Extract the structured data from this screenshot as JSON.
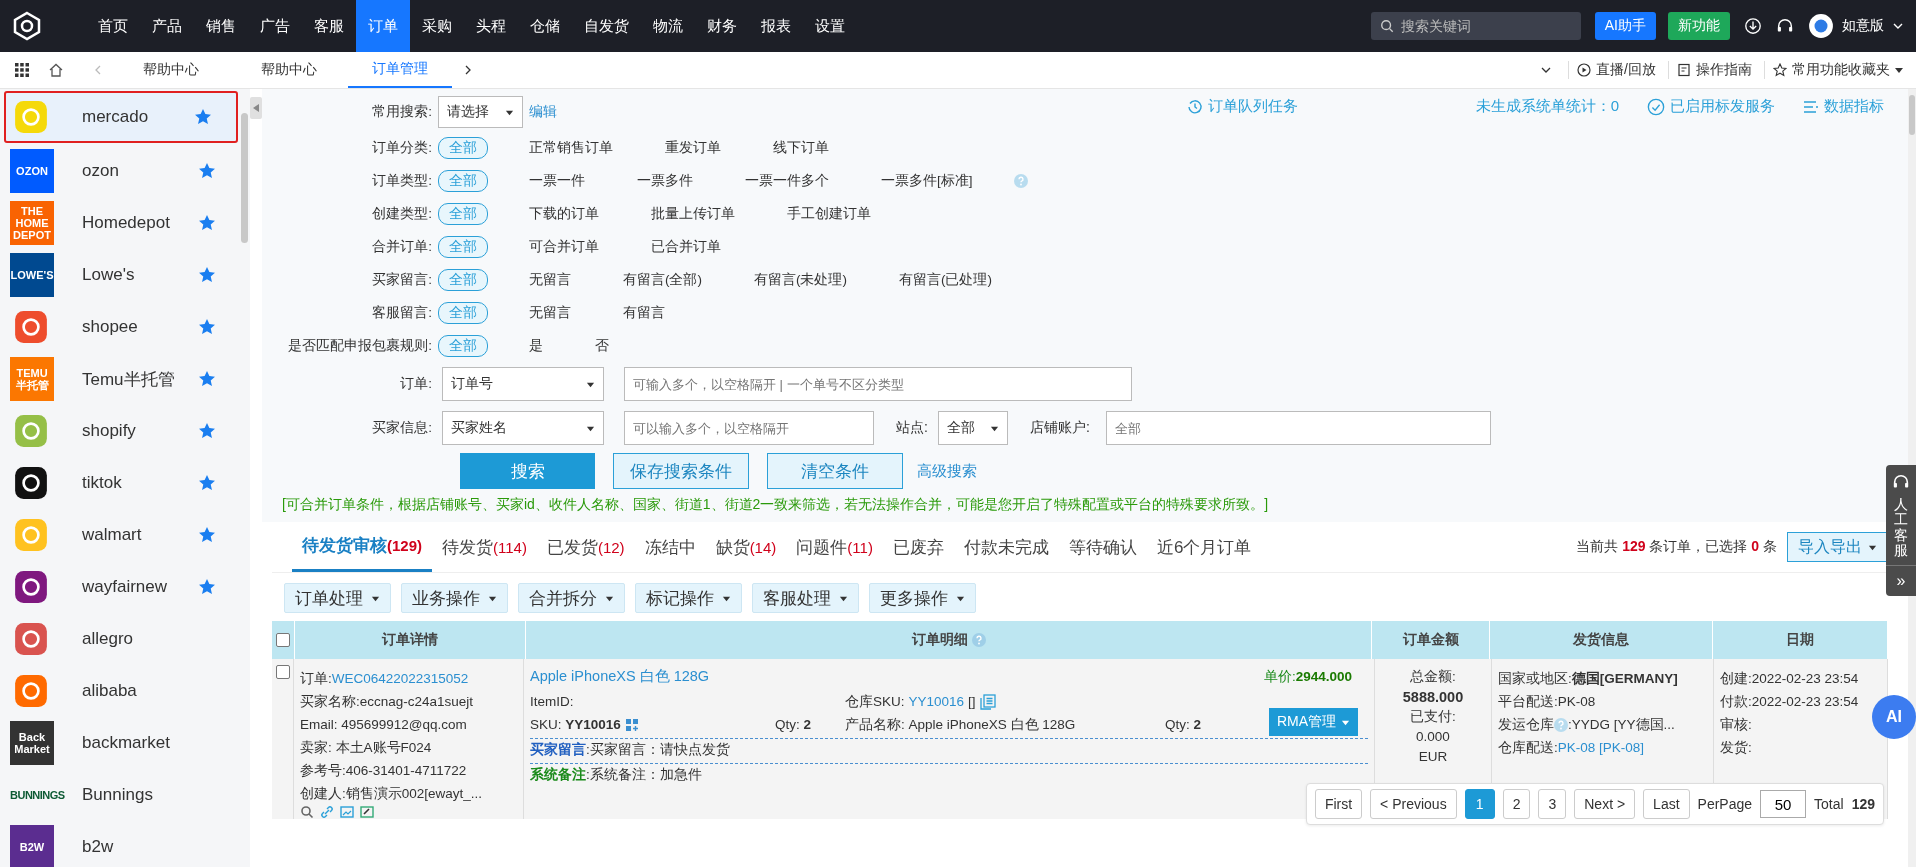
{
  "topnav": {
    "menu": [
      {
        "label": "首页",
        "selected": false
      },
      {
        "label": "产品",
        "selected": false
      },
      {
        "label": "销售",
        "selected": false
      },
      {
        "label": "广告",
        "selected": false
      },
      {
        "label": "客服",
        "selected": false
      },
      {
        "label": "订单",
        "selected": true
      },
      {
        "label": "采购",
        "selected": false
      },
      {
        "label": "头程",
        "selected": false
      },
      {
        "label": "仓储",
        "selected": false
      },
      {
        "label": "自发货",
        "selected": false
      },
      {
        "label": "物流",
        "selected": false
      },
      {
        "label": "财务",
        "selected": false
      },
      {
        "label": "报表",
        "selected": false
      },
      {
        "label": "设置",
        "selected": false
      }
    ],
    "search": {
      "placeholder": "搜索关键词"
    },
    "ai_button": "AI助手",
    "new_button": "新功能",
    "user": "如意版"
  },
  "breadcrumb": {
    "tabs": [
      {
        "label": "帮助中心",
        "selected": false
      },
      {
        "label": "帮助中心",
        "selected": false
      },
      {
        "label": "订单管理",
        "selected": true
      }
    ],
    "right_links": [
      "直播/回放",
      "操作指南",
      "常用功能收藏夹"
    ]
  },
  "sidebar": {
    "items": [
      {
        "name": "mercado",
        "kind": "glyph",
        "color": "#f5d90a",
        "starred": true,
        "selected": true
      },
      {
        "name": "ozon",
        "kind": "tile",
        "logo_text": "OZON",
        "color": "#005bff",
        "starred": true,
        "selected": false
      },
      {
        "name": "Homedepot",
        "kind": "tile",
        "logo_text": "THE HOME DEPOT",
        "color": "#f96302",
        "starred": true,
        "selected": false
      },
      {
        "name": "Lowe's",
        "kind": "tile",
        "logo_text": "LOWE'S",
        "color": "#004990",
        "starred": true,
        "selected": false
      },
      {
        "name": "shopee",
        "kind": "glyph",
        "color": "#ee4d2d",
        "starred": true,
        "selected": false
      },
      {
        "name": "Temu半托管",
        "kind": "tile",
        "logo_text": "TEMU 半托管",
        "color": "#fb7701",
        "starred": true,
        "selected": false
      },
      {
        "name": "shopify",
        "kind": "glyph",
        "color": "#95bf47",
        "starred": true,
        "selected": false
      },
      {
        "name": "tiktok",
        "kind": "glyph",
        "color": "#111111",
        "starred": true,
        "selected": false
      },
      {
        "name": "walmart",
        "kind": "glyph",
        "color": "#ffc220",
        "starred": true,
        "selected": false
      },
      {
        "name": "wayfairnew",
        "kind": "glyph",
        "color": "#7f187f",
        "starred": true,
        "selected": false
      },
      {
        "name": "allegro",
        "kind": "glyph",
        "color": "#d9534f",
        "starred": false,
        "selected": false
      },
      {
        "name": "alibaba",
        "kind": "glyph",
        "color": "#ff6a00",
        "starred": false,
        "selected": false
      },
      {
        "name": "backmarket",
        "kind": "tile",
        "logo_text": "Back Market",
        "color": "#333333",
        "starred": false,
        "selected": false
      },
      {
        "name": "Bunnings",
        "kind": "wordmark",
        "logo_text": "BUNNINGS",
        "color": "#0d5a34",
        "starred": false,
        "selected": false
      },
      {
        "name": "b2w",
        "kind": "tile",
        "logo_text": "B2W",
        "color": "#5b2d90",
        "starred": false,
        "selected": false
      }
    ]
  },
  "top_links": {
    "queue": "订单队列任务",
    "stats": "未生成系统单统计：0",
    "service": "已启用标发服务",
    "metrics": "数据指标"
  },
  "common_search": {
    "label": "常用搜索:",
    "select": "请选择",
    "edit": "编辑"
  },
  "filters": [
    {
      "label": "订单分类:",
      "help": false,
      "options": [
        {
          "label": "全部",
          "selected": true
        },
        {
          "label": "正常销售订单",
          "selected": false
        },
        {
          "label": "重发订单",
          "selected": false
        },
        {
          "label": "线下订单",
          "selected": false
        }
      ]
    },
    {
      "label": "订单类型:",
      "help": true,
      "options": [
        {
          "label": "全部",
          "selected": true
        },
        {
          "label": "一票一件",
          "selected": false
        },
        {
          "label": "一票多件",
          "selected": false
        },
        {
          "label": "一票一件多个",
          "selected": false
        },
        {
          "label": "一票多件[标准]",
          "selected": false
        }
      ]
    },
    {
      "label": "创建类型:",
      "help": false,
      "options": [
        {
          "label": "全部",
          "selected": true
        },
        {
          "label": "下载的订单",
          "selected": false
        },
        {
          "label": "批量上传订单",
          "selected": false
        },
        {
          "label": "手工创建订单",
          "selected": false
        }
      ]
    },
    {
      "label": "合并订单:",
      "help": false,
      "options": [
        {
          "label": "全部",
          "selected": true
        },
        {
          "label": "可合并订单",
          "selected": false
        },
        {
          "label": "已合并订单",
          "selected": false
        }
      ]
    },
    {
      "label": "买家留言:",
      "help": false,
      "options": [
        {
          "label": "全部",
          "selected": true
        },
        {
          "label": "无留言",
          "selected": false
        },
        {
          "label": "有留言(全部)",
          "selected": false
        },
        {
          "label": "有留言(未处理)",
          "selected": false
        },
        {
          "label": "有留言(已处理)",
          "selected": false
        }
      ]
    },
    {
      "label": "客服留言:",
      "help": false,
      "options": [
        {
          "label": "全部",
          "selected": true
        },
        {
          "label": "无留言",
          "selected": false
        },
        {
          "label": "有留言",
          "selected": false
        }
      ]
    },
    {
      "label": "是否匹配申报包裹规则:",
      "help": false,
      "options": [
        {
          "label": "全部",
          "selected": true
        },
        {
          "label": "是",
          "selected": false
        },
        {
          "label": "否",
          "selected": false
        }
      ]
    }
  ],
  "order_field": {
    "label": "订单:",
    "select": "订单号",
    "placeholder": "可输入多个，以空格隔开 | 一个单号不区分类型"
  },
  "buyer_field": {
    "label": "买家信息:",
    "select": "买家姓名",
    "placeholder": "可以输入多个，以空格隔开",
    "site_label": "站点:",
    "site_select": "全部",
    "shop_label": "店铺账户:",
    "shop_placeholder": "全部"
  },
  "buttons": {
    "search": "搜索",
    "save": "保存搜索条件",
    "clear": "清空条件",
    "advanced": "高级搜索"
  },
  "note": "[可合并订单条件，根据店铺账号、买家id、收件人名称、国家、街道1、街道2一致来筛选，若无法操作合并，可能是您开启了特殊配置或平台的特殊要求所致。]",
  "status_tabs": [
    {
      "label": "待发货审核",
      "count": "(129)",
      "selected": true
    },
    {
      "label": "待发货",
      "count": "(114)",
      "selected": false
    },
    {
      "label": "已发货",
      "count": "(12)",
      "selected": false
    },
    {
      "label": "冻结中",
      "selected": false
    },
    {
      "label": "缺货",
      "count": "(14)",
      "selected": false
    },
    {
      "label": "问题件",
      "count": "(11)",
      "selected": false
    },
    {
      "label": "已废弃",
      "selected": false
    },
    {
      "label": "付款未完成",
      "selected": false
    },
    {
      "label": "等待确认",
      "selected": false
    },
    {
      "label": "近6个月订单",
      "selected": false
    }
  ],
  "summary": "当前共 **129** 条订单，已选择 **0** 条",
  "export_button": "导入导出",
  "actions": [
    "订单处理",
    "业务操作",
    "合并拆分",
    "标记操作",
    "客服处理",
    "更多操作"
  ],
  "table": {
    "select_all": false,
    "columns": [
      "订单详情",
      "订单明细",
      "订单金额",
      "发货信息",
      "日期"
    ],
    "row": {
      "checked": false,
      "order_label": "订单:",
      "order_no": "WEC06422022315052",
      "details": [
        "买家名称:eccnag-c24a1suejt",
        "Email: 495699912@qq.com",
        "卖家: 本土A账号F024",
        "参考号:406-31401-4711722",
        "创建人:销售演示002[ewayt_..."
      ],
      "product_title": "Apple iPhoneXS 白色 128G",
      "unit_price_label": "单价:",
      "unit_price": "2944.000",
      "item_id": "ItemID:",
      "sku": "SKU: **YY10016**",
      "qty": "Qty: **2**",
      "wh_sku_label": "仓库SKU:",
      "wh_sku": "YY10016",
      "wh_sku_suffix": "[]",
      "wh_qty": "Qty: **2**",
      "rma_button": "RMA管理",
      "product_name": "产品名称: Apple iPhoneXS 白色 128G",
      "buyer_note_label": "买家留言",
      "buyer_note": ":买家留言：请快点发货",
      "system_note_label": "系统备注",
      "system_note": ":系统备注：加急件",
      "amount": [
        "总金额:",
        "5888.000",
        "已支付:",
        "0.000",
        "EUR"
      ],
      "shipping": [
        "国家或地区:**德国[GERMANY]**",
        "平台配送:PK-08"
      ],
      "warehouse_label": "发运仓库",
      "warehouse_value": ":YYDG [YY德国...",
      "delivery_label": "仓库配送:",
      "delivery_value": "PK-08 [PK-08]",
      "dates": [
        "创建:2022-02-23 23:54",
        "付款:2022-02-23 23:54",
        "审核:",
        "发货:"
      ]
    }
  },
  "pagination": {
    "first": "First",
    "previous": "< Previous",
    "pages": [
      {
        "label": "1",
        "selected": true
      },
      {
        "label": "2",
        "selected": false
      },
      {
        "label": "3",
        "selected": false
      }
    ],
    "next": "Next >",
    "last": "Last",
    "per_page_label": "PerPage",
    "per_page": "50",
    "total_label": "Total",
    "total": "129"
  },
  "support": {
    "label": "人工客服",
    "expand": "»",
    "ai": "AI"
  }
}
